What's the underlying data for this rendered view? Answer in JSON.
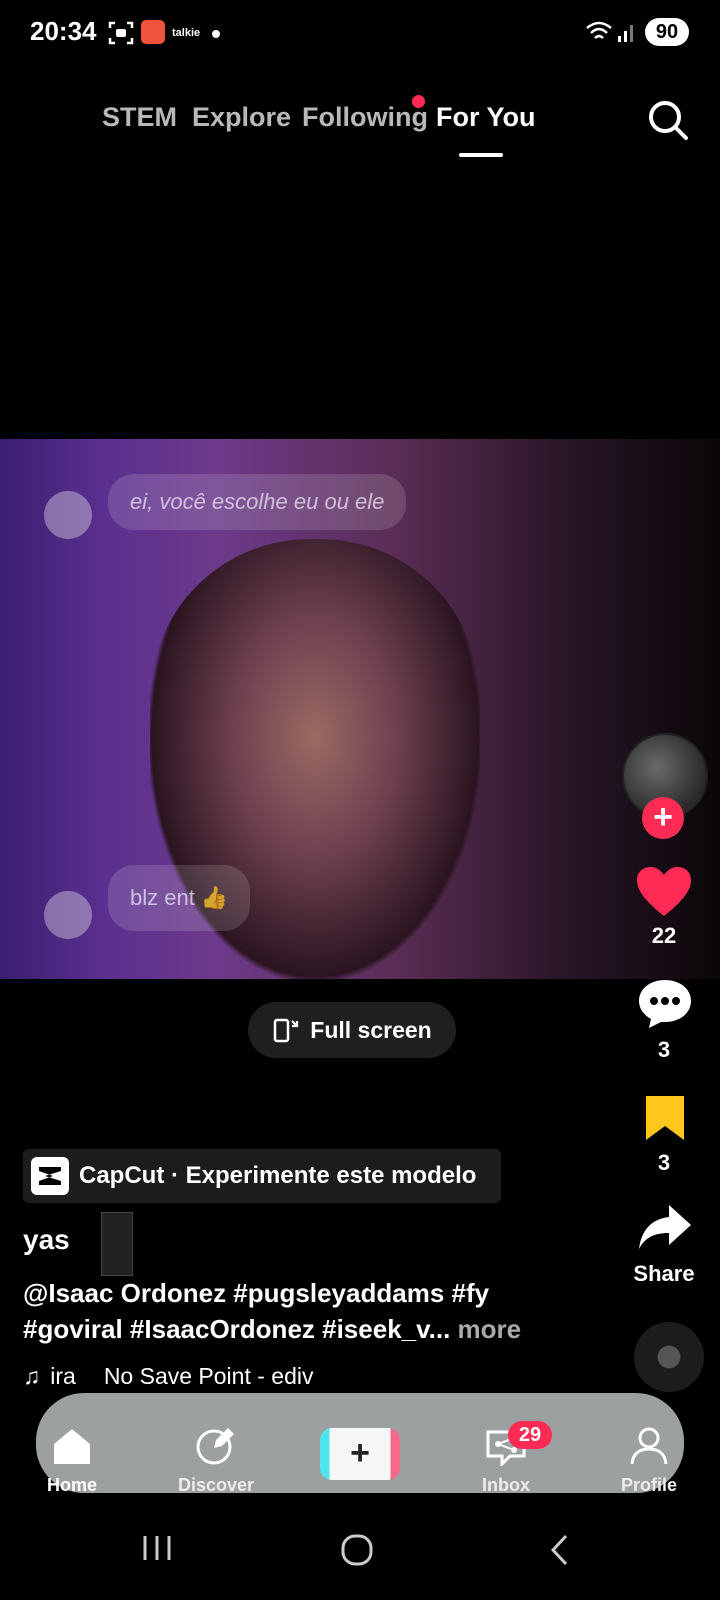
{
  "status_bar": {
    "time": "20:34",
    "app_label": "talkie",
    "battery": "90"
  },
  "top_tabs": [
    {
      "label": "STEM"
    },
    {
      "label": "Explore"
    },
    {
      "label": "Following"
    },
    {
      "label": "For You"
    }
  ],
  "video": {
    "bubble_1": "ei, você escolhe eu ou ele",
    "bubble_2": "blz ent 👍"
  },
  "side_actions": {
    "likes": "22",
    "comments": "3",
    "saves": "3",
    "share_label": "Share"
  },
  "fullscreen_label": "Full screen",
  "capcut_banner": "CapCut · Experimente este modelo",
  "post": {
    "username": "yas",
    "caption_line1": "@Isaac Ordonez #pugsleyaddams #fy",
    "caption_line2": "#goviral #IsaacOrdonez #iseek_v...",
    "more_label": "more",
    "music_left": "ira",
    "music_right": "No Save Point - ediv"
  },
  "bottom_nav": [
    {
      "label": "Home"
    },
    {
      "label": "Discover"
    },
    {
      "label": "Inbox"
    },
    {
      "label": "Profile"
    }
  ],
  "inbox_badge": "29",
  "colors": {
    "accent": "#fe2c55",
    "save": "#ffc61b"
  }
}
